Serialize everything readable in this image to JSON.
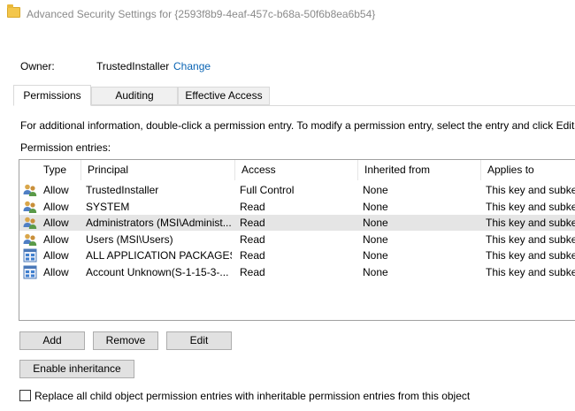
{
  "window": {
    "title": "Advanced Security Settings for {2593f8b9-4eaf-457c-b68a-50f6b8ea6b54}"
  },
  "owner": {
    "label": "Owner:",
    "value": "TrustedInstaller",
    "change_link": "Change"
  },
  "tabs": [
    {
      "label": "Permissions",
      "active": true
    },
    {
      "label": "Auditing",
      "active": false
    },
    {
      "label": "Effective Access",
      "active": false
    }
  ],
  "info_text": "For additional information, double-click a permission entry. To modify a permission entry, select the entry and click Edit (if",
  "entries_label": "Permission entries:",
  "columns": [
    "Type",
    "Principal",
    "Access",
    "Inherited from",
    "Applies to"
  ],
  "rows": [
    {
      "icon": "users-icon",
      "type": "Allow",
      "principal": "TrustedInstaller",
      "access": "Full Control",
      "inherited": "None",
      "applies": "This key and subkey",
      "selected": false
    },
    {
      "icon": "users-icon",
      "type": "Allow",
      "principal": "SYSTEM",
      "access": "Read",
      "inherited": "None",
      "applies": "This key and subkey",
      "selected": false
    },
    {
      "icon": "users-icon",
      "type": "Allow",
      "principal": "Administrators (MSI\\Administ...",
      "access": "Read",
      "inherited": "None",
      "applies": "This key and subkey",
      "selected": true
    },
    {
      "icon": "users-icon",
      "type": "Allow",
      "principal": "Users (MSI\\Users)",
      "access": "Read",
      "inherited": "None",
      "applies": "This key and subkey",
      "selected": false
    },
    {
      "icon": "app-packages-icon",
      "type": "Allow",
      "principal": "ALL APPLICATION PACKAGES",
      "access": "Read",
      "inherited": "None",
      "applies": "This key and subkey",
      "selected": false
    },
    {
      "icon": "app-packages-icon",
      "type": "Allow",
      "principal": "Account Unknown(S-1-15-3-...",
      "access": "Read",
      "inherited": "None",
      "applies": "This key and subkey",
      "selected": false
    }
  ],
  "buttons": {
    "add": "Add",
    "remove": "Remove",
    "edit": "Edit",
    "enable_inheritance": "Enable inheritance"
  },
  "replace_checkbox": {
    "label": "Replace all child object permission entries with inheritable permission entries from this object",
    "checked": false
  },
  "colors": {
    "link": "#0a64b4",
    "selected_row": "#e5e5e5",
    "button_face": "#e1e1e1"
  }
}
